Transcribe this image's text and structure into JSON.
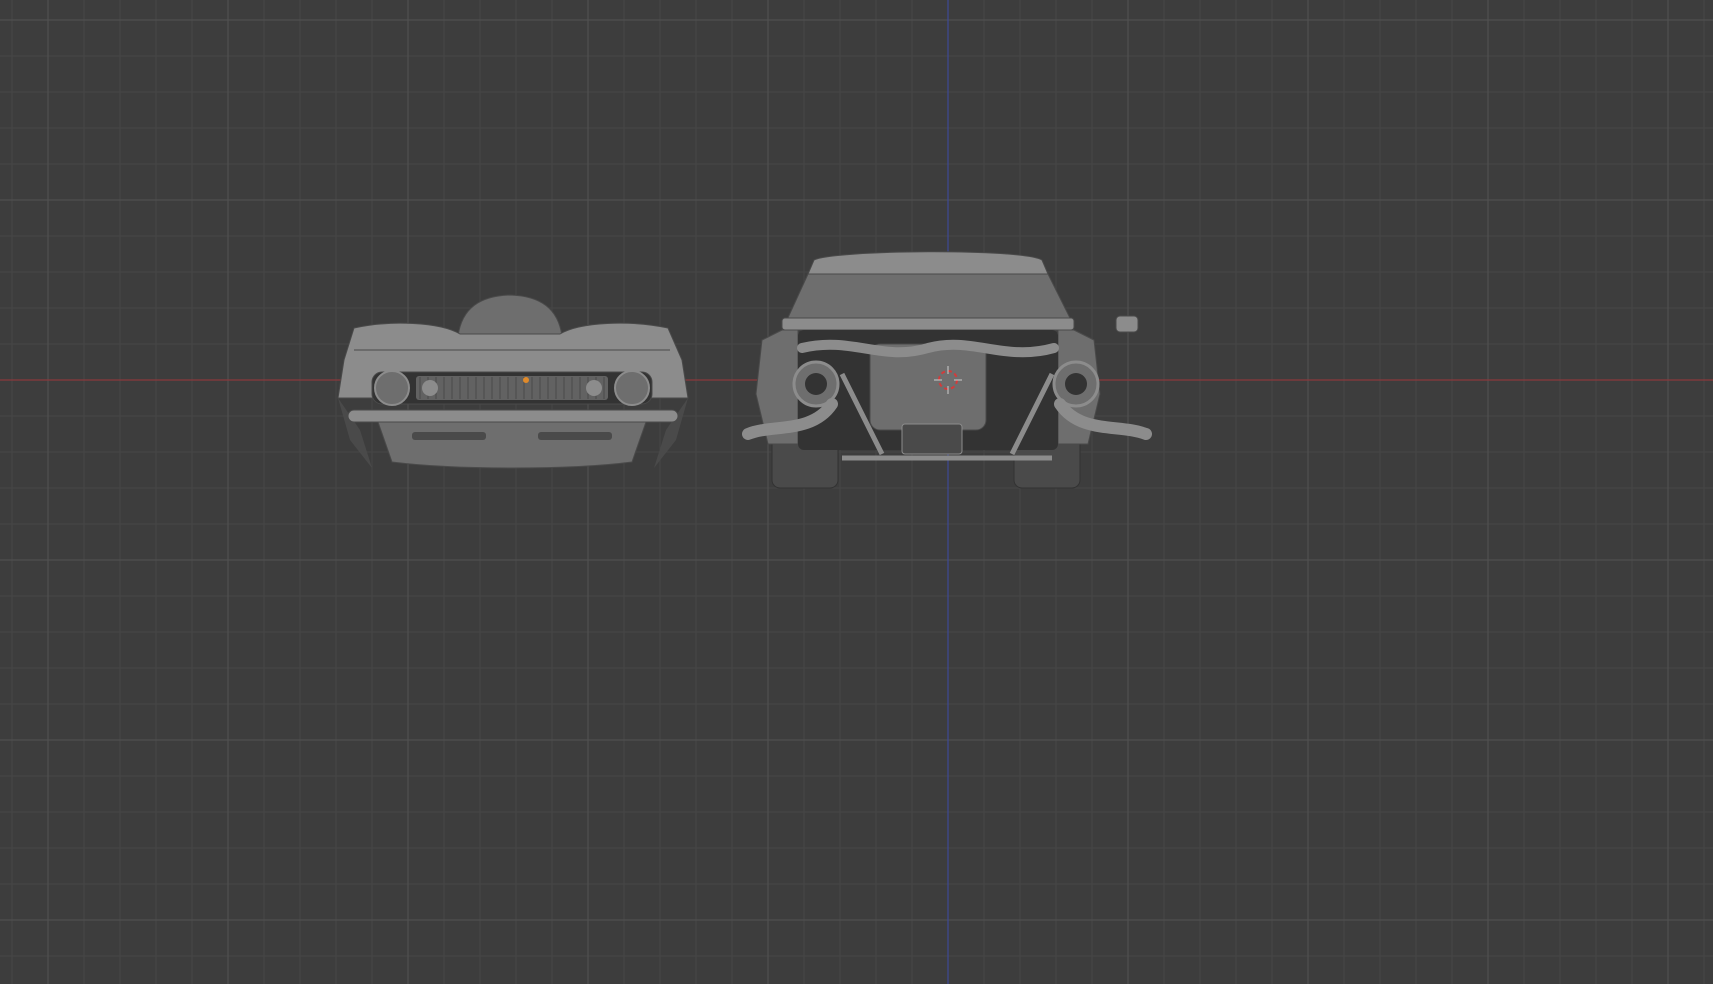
{
  "viewport": {
    "view": "front-orthographic",
    "show_grid": true,
    "colors": {
      "background": "#3d3d3d",
      "grid_minor": "#474747",
      "grid_major": "#525252",
      "x_axis": "#8a3a3c",
      "z_axis": "#3e4a96",
      "model_light": "#8c8c8c",
      "model_mid": "#6e6e6e",
      "model_dark": "#4a4a4a",
      "model_deep": "#333333",
      "cursor": "#d23b3b",
      "origin": "#e08a2a"
    }
  },
  "scene": {
    "objects": [
      {
        "id": "car-body-front",
        "icon": "car-front-mesh"
      },
      {
        "id": "car-chassis-front",
        "icon": "car-chassis-mesh"
      }
    ],
    "cursor_icon": "3d-cursor-icon"
  }
}
